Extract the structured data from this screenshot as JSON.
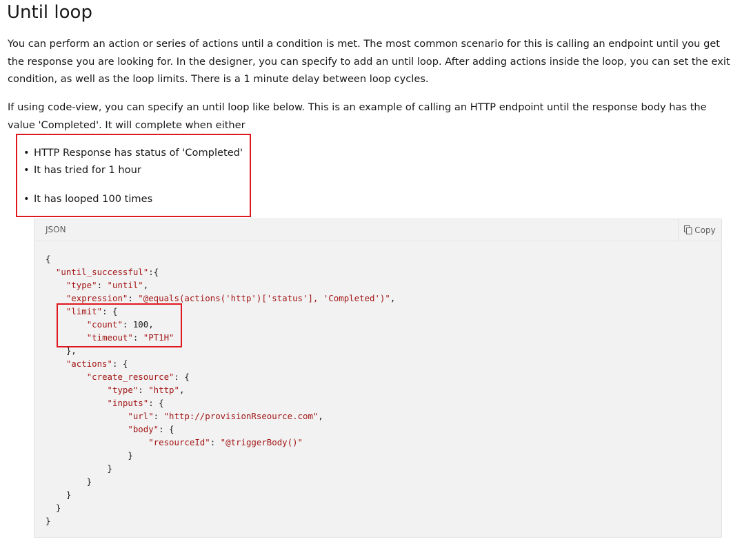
{
  "page": {
    "title": "Until loop",
    "para1": "You can perform an action or series of actions until a condition is met. The most common scenario for this is calling an endpoint until you get the response you are looking for. In the designer, you can specify to add an until loop. After adding actions inside the loop, you can set the exit condition, as well as the loop limits. There is a 1 minute delay between loop cycles.",
    "para2": "If using code-view, you can specify an until loop like below. This is an example of calling an HTTP endpoint until the response body has the value 'Completed'. It will complete when either",
    "bullets": [
      "HTTP Response has status of 'Completed'",
      "It has tried for 1 hour",
      "It has looped 100 times"
    ]
  },
  "code_block": {
    "language": "JSON",
    "copy_label": "Copy",
    "copy_icon": "copy-icon",
    "highlight_color": "#e0171e",
    "lines": [
      "{",
      "  \"until_successful\":{",
      "    \"type\": \"until\",",
      "    \"expression\": \"@equals(actions('http')['status'], 'Completed')\",",
      "    \"limit\": {",
      "        \"count\": 100,",
      "        \"timeout\": \"PT1H\"",
      "    },",
      "    \"actions\": {",
      "        \"create_resource\": {",
      "            \"type\": \"http\",",
      "            \"inputs\": {",
      "                \"url\": \"http://provisionRseource.com\",",
      "                \"body\": {",
      "                    \"resourceId\": \"@triggerBody()\"",
      "                }",
      "            }",
      "        }",
      "    }",
      "  }",
      "}"
    ]
  }
}
